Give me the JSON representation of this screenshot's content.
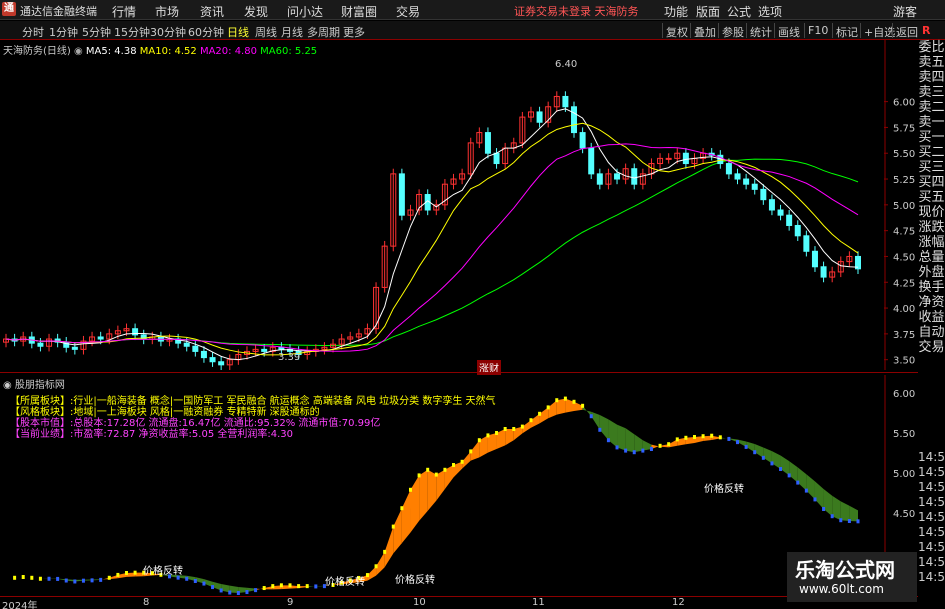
{
  "titlebar": {
    "app_title": "通达信金融终端",
    "menus": [
      "行情",
      "市场",
      "资讯",
      "发现",
      "问小达",
      "财富圈",
      "交易"
    ],
    "notice": "证券交易未登录 天海防务",
    "right_menus": [
      "功能",
      "版面",
      "公式",
      "选项",
      "游客"
    ]
  },
  "toolbar": {
    "periods": [
      "分时",
      "1分钟",
      "5分钟",
      "15分钟",
      "30分钟",
      "60分钟",
      "日线",
      "周线",
      "月线",
      "多周期",
      "更多"
    ],
    "active_period": "日线",
    "buttons": [
      "复权",
      "叠加",
      "参股",
      "统计",
      "画线",
      "F10",
      "标记",
      "+自选",
      "返回"
    ],
    "corner": "R"
  },
  "right_labels": [
    "委比",
    "卖五",
    "卖四",
    "卖三",
    "卖二",
    "卖一",
    "买一",
    "买二",
    "买三",
    "买四",
    "买五",
    "现价",
    "涨跌",
    "涨幅",
    "总量",
    "外盘",
    "换手",
    "净资",
    "收益",
    "自动",
    "交易"
  ],
  "clock_labels": [
    "14:5",
    "14:5",
    "14:5",
    "14:5",
    "14:5",
    "14:5",
    "14:5",
    "14:5",
    "14:5",
    "14:5"
  ],
  "legend_main": {
    "name": "天海防务(日线)",
    "ma5": "MA5: 4.38",
    "ma10": "MA10: 4.52",
    "ma20": "MA20: 4.80",
    "ma60": "MA60: 5.25",
    "colors": {
      "ma5": "#ffffff",
      "ma10": "#ffff00",
      "ma20": "#ff00ff",
      "ma60": "#00ff00"
    }
  },
  "annotations": {
    "high": "6.40",
    "low": "3.39",
    "tag": "涨财",
    "signal": "价格反转"
  },
  "legend_ind": "股朋指标网",
  "info": {
    "r1_label": "【所属板块】:",
    "r1_val": "行业|一船海装备 概念|一国防军工 军民融合 航运概念 高端装备 风电 垃圾分类 数字孪生 天然气",
    "r2_label": "【风格板块】:",
    "r2_val": "地域|一上海板块 风格|一融资融券 专精特新 深股通标的",
    "r3_label": "【股本市值】:",
    "r3_val": "总股本:17.28亿 流通盘:16.47亿 流通比:95.32% 流通市值:70.99亿",
    "r4_label": "【当前业绩】:",
    "r4_val": "市盈率:72.87 净资收益率:5.05 全营利润率:4.30"
  },
  "xaxis": [
    "2024年",
    "8",
    "9",
    "10",
    "11",
    "12"
  ],
  "watermark": {
    "line1": "乐淘公式网",
    "line2": "www.60lt.com"
  },
  "chart_data": {
    "type": "candlestick",
    "title": "天海防务(日线)",
    "ylim": [
      3.4,
      6.5
    ],
    "y_ticks": [
      "6.00",
      "5.75",
      "5.50",
      "5.25",
      "5.00",
      "4.75",
      "4.50",
      "4.25",
      "4.00",
      "3.75",
      "3.50"
    ],
    "ind_ticks": [
      "6.00",
      "5.50",
      "5.00",
      "4.50"
    ],
    "closes": [
      3.7,
      3.68,
      3.72,
      3.66,
      3.63,
      3.7,
      3.67,
      3.62,
      3.6,
      3.68,
      3.72,
      3.7,
      3.75,
      3.78,
      3.8,
      3.74,
      3.7,
      3.72,
      3.68,
      3.7,
      3.66,
      3.63,
      3.58,
      3.52,
      3.48,
      3.45,
      3.5,
      3.55,
      3.58,
      3.6,
      3.58,
      3.62,
      3.6,
      3.58,
      3.55,
      3.58,
      3.6,
      3.62,
      3.65,
      3.7,
      3.72,
      3.75,
      3.8,
      4.2,
      4.6,
      5.3,
      4.9,
      4.95,
      5.1,
      4.95,
      5.0,
      5.2,
      5.25,
      5.3,
      5.6,
      5.7,
      5.5,
      5.4,
      5.55,
      5.6,
      5.85,
      5.9,
      5.8,
      5.95,
      6.05,
      5.95,
      5.7,
      5.55,
      5.3,
      5.2,
      5.3,
      5.25,
      5.35,
      5.2,
      5.3,
      5.4,
      5.45,
      5.45,
      5.5,
      5.4,
      5.45,
      5.5,
      5.48,
      5.4,
      5.3,
      5.25,
      5.2,
      5.15,
      5.05,
      4.95,
      4.9,
      4.8,
      4.7,
      4.55,
      4.4,
      4.3,
      4.35,
      4.45,
      4.5,
      4.38
    ]
  }
}
